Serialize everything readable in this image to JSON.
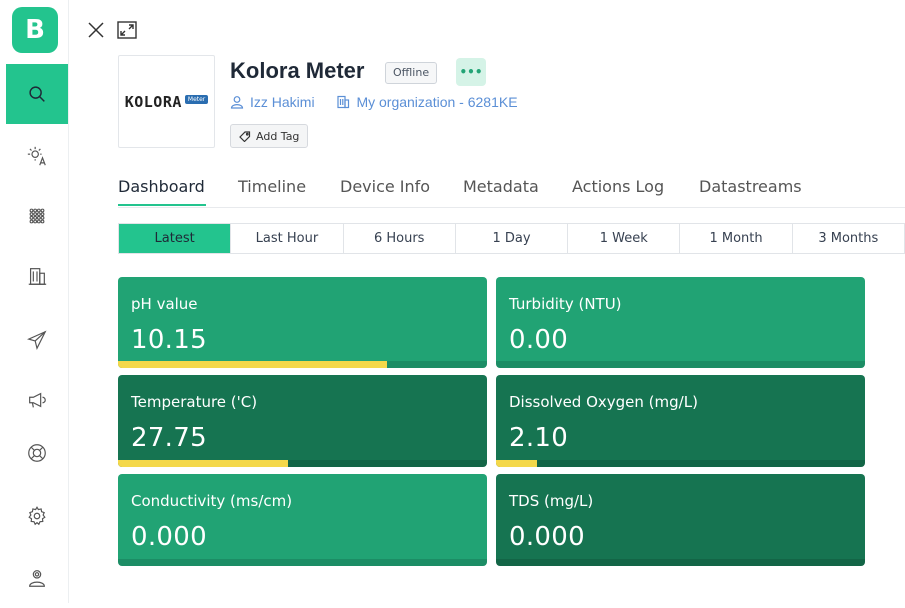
{
  "sidebar": {
    "logo": "B",
    "items": [
      {
        "icon": "search-icon",
        "active": true
      },
      {
        "icon": "sun-a-icon",
        "active": false
      },
      {
        "icon": "grid-icon",
        "active": false
      },
      {
        "icon": "building-icon",
        "active": false
      },
      {
        "icon": "send-icon",
        "active": false
      },
      {
        "icon": "megaphone-icon",
        "active": false
      },
      {
        "icon": "lifebuoy-icon",
        "active": false
      },
      {
        "icon": "gear-icon",
        "active": false
      },
      {
        "icon": "user-icon",
        "active": false
      }
    ]
  },
  "device": {
    "logo_text": "KOLORA",
    "logo_sub": "Meter",
    "title": "Kolora Meter",
    "status": "Offline",
    "more": "•••",
    "owner": "Izz Hakimi",
    "organization": "My organization - 6281KE",
    "add_tag": "Add Tag"
  },
  "tabs": [
    "Dashboard",
    "Timeline",
    "Device Info",
    "Metadata",
    "Actions Log",
    "Datastreams"
  ],
  "active_tab": "Dashboard",
  "time_ranges": [
    "Latest",
    "Last Hour",
    "6 Hours",
    "1 Day",
    "1 Week",
    "1 Month",
    "3 Months"
  ],
  "active_range": "Latest",
  "colors": {
    "accent": "#23c48e",
    "card_light": "#21a374",
    "card_dark": "#167451",
    "bar_fill": "#f4d84a"
  },
  "cards": [
    {
      "label": "pH value",
      "value": "10.15",
      "level": 0.73
    },
    {
      "label": "Turbidity (NTU)",
      "value": "0.00",
      "level": 0
    },
    {
      "label": "Temperature ('C)",
      "value": "27.75",
      "level": 0.46
    },
    {
      "label": "Dissolved Oxygen (mg/L)",
      "value": "2.10",
      "level": 0.11
    },
    {
      "label": "Conductivity (ms/cm)",
      "value": "0.000",
      "level": 0
    },
    {
      "label": "TDS (mg/L)",
      "value": "0.000",
      "level": 0
    }
  ]
}
